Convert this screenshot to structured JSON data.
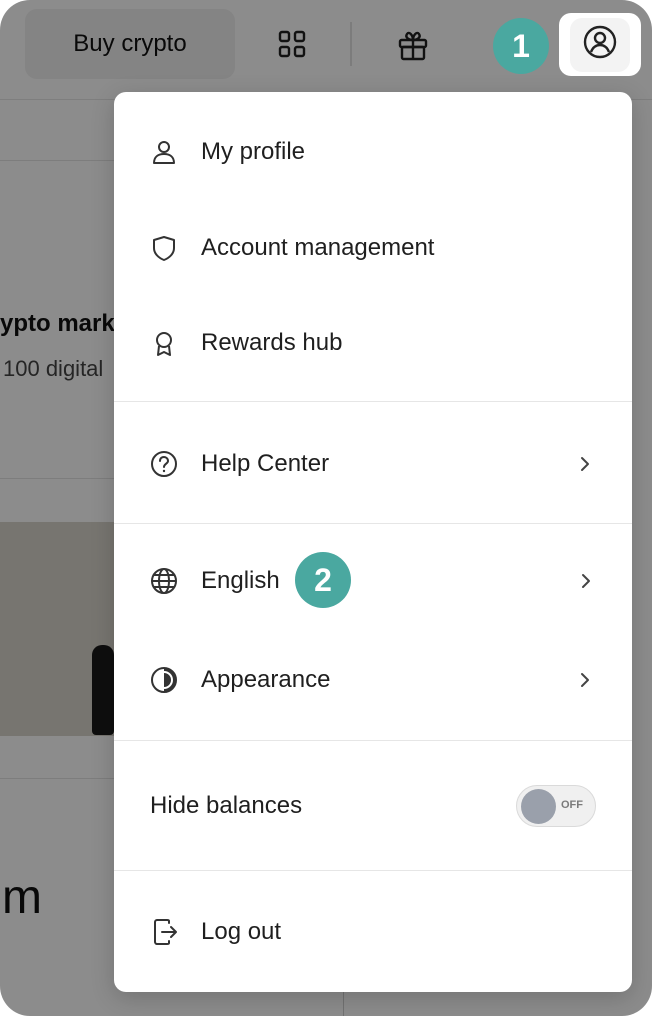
{
  "header": {
    "buy_label": "Buy crypto",
    "icons": [
      "grid-icon",
      "gift-icon",
      "user-circle-icon"
    ]
  },
  "background": {
    "title_fragment": "ypto mark",
    "subtitle_fragment": "100 digital",
    "big_text_fragment": "m"
  },
  "menu": {
    "items": [
      {
        "label": "My profile",
        "icon": "user-icon"
      },
      {
        "label": "Account management",
        "icon": "shield-icon"
      },
      {
        "label": "Rewards hub",
        "icon": "award-icon"
      },
      {
        "label": "Help Center",
        "icon": "help-circle-icon"
      },
      {
        "label": "English",
        "icon": "globe-icon"
      },
      {
        "label": "Appearance",
        "icon": "contrast-icon"
      },
      {
        "label": "Hide balances",
        "toggle_text": "OFF"
      },
      {
        "label": "Log out",
        "icon": "logout-icon"
      }
    ]
  },
  "badges": {
    "first": "1",
    "second": "2"
  },
  "colors": {
    "badge": "#4aa8a0",
    "overlay": "rgba(0,0,0,0.45)"
  }
}
